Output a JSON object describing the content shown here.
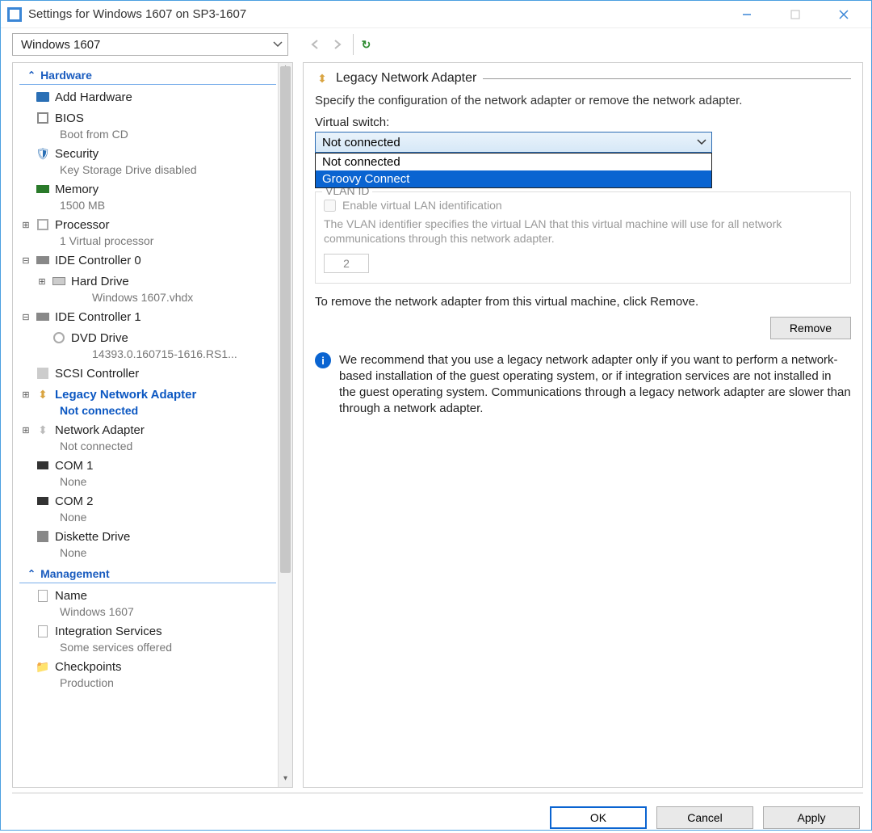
{
  "window": {
    "title": "Settings for Windows 1607 on SP3-1607"
  },
  "vm_selector": {
    "value": "Windows 1607"
  },
  "sidebar": {
    "sections": {
      "hardware": "Hardware",
      "management": "Management"
    },
    "items": {
      "add_hw": "Add Hardware",
      "bios": "BIOS",
      "bios_sub": "Boot from CD",
      "security": "Security",
      "security_sub": "Key Storage Drive disabled",
      "memory": "Memory",
      "memory_sub": "1500 MB",
      "processor": "Processor",
      "processor_sub": "1 Virtual processor",
      "ide0": "IDE Controller 0",
      "hdd": "Hard Drive",
      "hdd_sub": "Windows 1607.vhdx",
      "ide1": "IDE Controller 1",
      "dvd": "DVD Drive",
      "dvd_sub": "14393.0.160715-1616.RS1...",
      "scsi": "SCSI Controller",
      "legacy_net": "Legacy Network Adapter",
      "legacy_net_sub": "Not connected",
      "net": "Network Adapter",
      "net_sub": "Not connected",
      "com1": "COM 1",
      "com1_sub": "None",
      "com2": "COM 2",
      "com2_sub": "None",
      "diskette": "Diskette Drive",
      "diskette_sub": "None",
      "name": "Name",
      "name_sub": "Windows 1607",
      "intsvc": "Integration Services",
      "intsvc_sub": "Some services offered",
      "checkpoints": "Checkpoints",
      "checkpoints_sub": "Production"
    }
  },
  "main": {
    "heading": "Legacy Network Adapter",
    "description": "Specify the configuration of the network adapter or remove the network adapter.",
    "switch_label": "Virtual switch:",
    "switch_value": "Not connected",
    "switch_options": [
      "Not connected",
      "Groovy Connect"
    ],
    "vlan_group_title": "VLAN ID",
    "vlan_checkbox": "Enable virtual LAN identification",
    "vlan_desc": "The VLAN identifier specifies the virtual LAN that this virtual machine will use for all network communications through this network adapter.",
    "vlan_value": "2",
    "remove_text": "To remove the network adapter from this virtual machine, click Remove.",
    "remove_btn": "Remove",
    "info_text": "We recommend that you use a legacy network adapter only if you want to perform a network-based installation of the guest operating system, or if integration services are not installed in the guest operating system. Communications through a legacy network adapter are slower than through a network adapter."
  },
  "footer": {
    "ok": "OK",
    "cancel": "Cancel",
    "apply": "Apply"
  }
}
